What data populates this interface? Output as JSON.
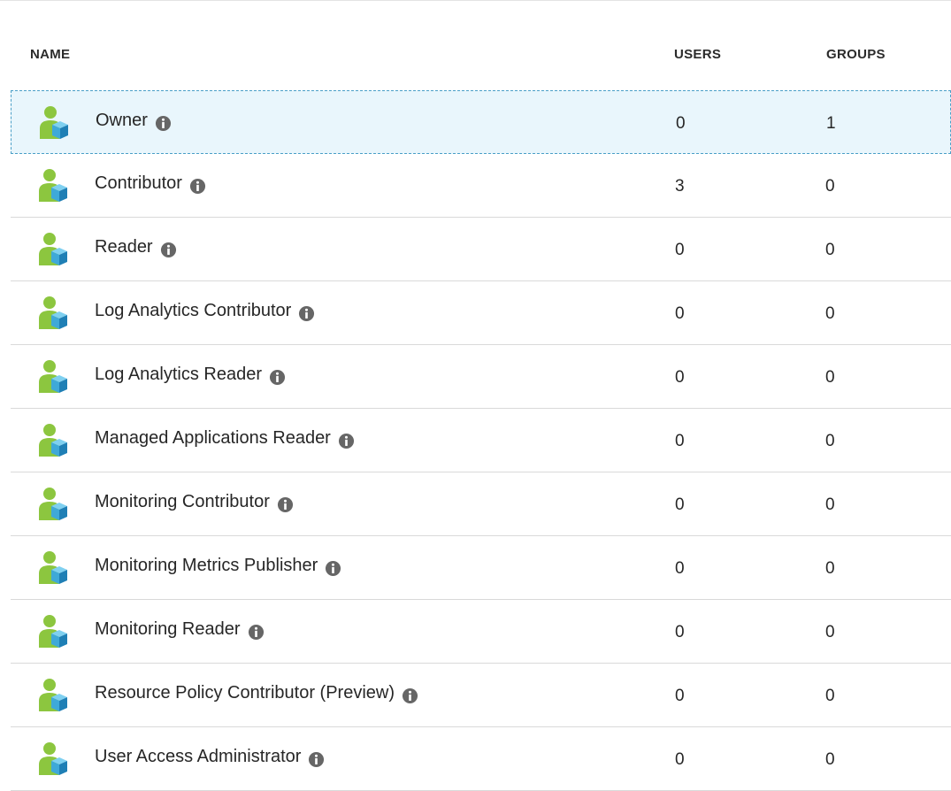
{
  "table": {
    "headers": {
      "name": "NAME",
      "users": "USERS",
      "groups": "GROUPS"
    },
    "rows": [
      {
        "name": "Owner",
        "users": "0",
        "groups": "1",
        "selected": true
      },
      {
        "name": "Contributor",
        "users": "3",
        "groups": "0",
        "selected": false
      },
      {
        "name": "Reader",
        "users": "0",
        "groups": "0",
        "selected": false
      },
      {
        "name": "Log Analytics Contributor",
        "users": "0",
        "groups": "0",
        "selected": false
      },
      {
        "name": "Log Analytics Reader",
        "users": "0",
        "groups": "0",
        "selected": false
      },
      {
        "name": "Managed Applications Reader",
        "users": "0",
        "groups": "0",
        "selected": false
      },
      {
        "name": "Monitoring Contributor",
        "users": "0",
        "groups": "0",
        "selected": false
      },
      {
        "name": "Monitoring Metrics Publisher",
        "users": "0",
        "groups": "0",
        "selected": false
      },
      {
        "name": "Monitoring Reader",
        "users": "0",
        "groups": "0",
        "selected": false
      },
      {
        "name": "Resource Policy Contributor (Preview)",
        "users": "0",
        "groups": "0",
        "selected": false
      },
      {
        "name": "User Access Administrator",
        "users": "0",
        "groups": "0",
        "selected": false
      }
    ]
  },
  "icons": {
    "role": "role-user-cube-icon",
    "info": "info-icon"
  },
  "colors": {
    "selected_bg": "#e9f6fc",
    "selected_border": "#4a9fc7",
    "row_divider": "#d9d9d9",
    "icon_person_green": "#8cc63f",
    "icon_cube_blue": "#3fa9d8",
    "info_gray": "#666666"
  }
}
